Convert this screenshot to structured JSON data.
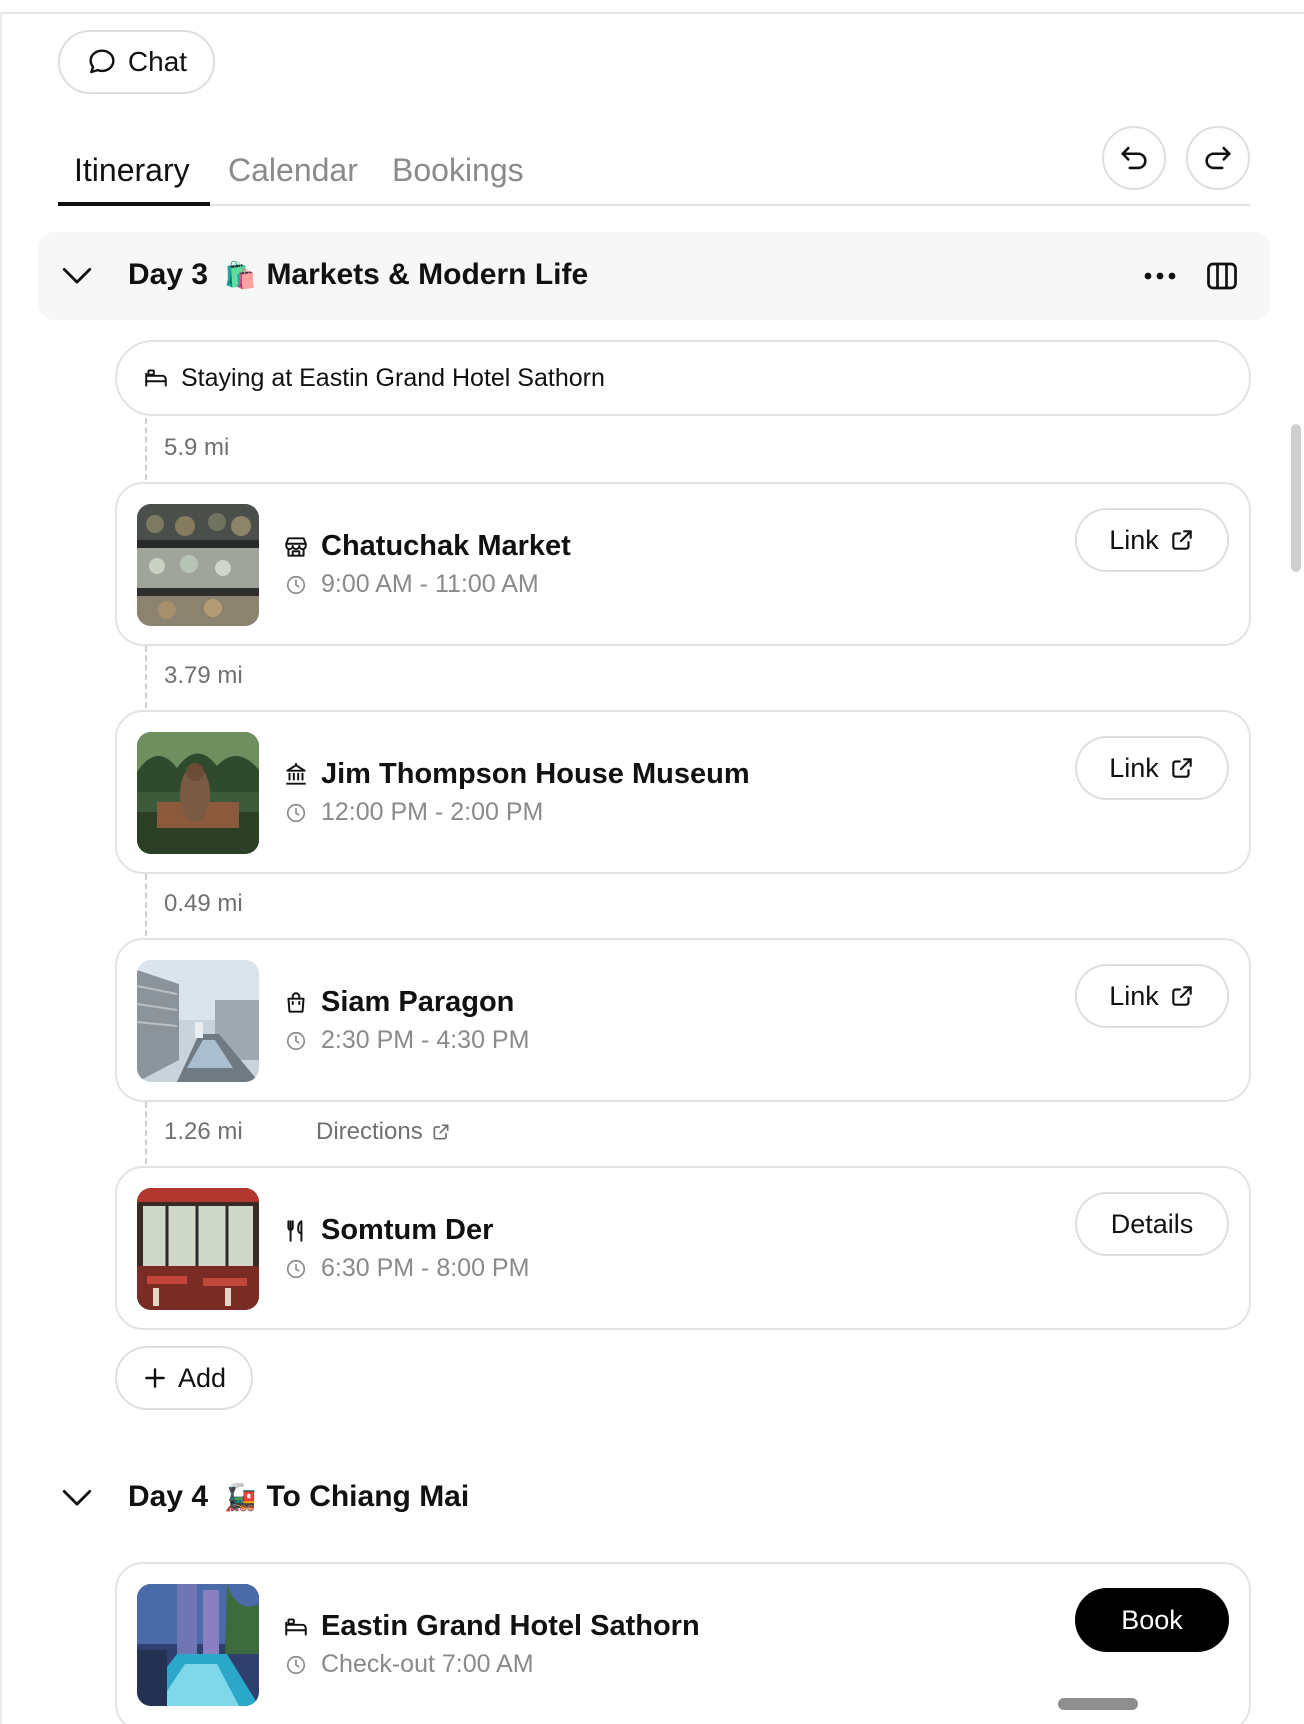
{
  "chat_button": {
    "label": "Chat",
    "icon": "chat-bubble-icon"
  },
  "tabs": [
    {
      "label": "Itinerary",
      "active": true
    },
    {
      "label": "Calendar",
      "active": false
    },
    {
      "label": "Bookings",
      "active": false
    }
  ],
  "toolbar": {
    "undo_icon": "undo-icon",
    "redo_icon": "redo-icon"
  },
  "day3": {
    "day_label": "Day 3",
    "emoji": "🛍️",
    "title": "Markets & Modern Life",
    "stay": "Staying at Eastin Grand Hotel Sathorn",
    "distances": [
      "5.9 mi",
      "3.79 mi",
      "0.49 mi",
      "1.26 mi"
    ],
    "directions_label": "Directions",
    "items": [
      {
        "name": "Chatuchak Market",
        "time": "9:00 AM  -  11:00 AM",
        "button": "Link",
        "icon": "storefront-icon"
      },
      {
        "name": "Jim Thompson House Museum",
        "time": "12:00 PM  -  2:00 PM",
        "button": "Link",
        "icon": "museum-icon"
      },
      {
        "name": "Siam Paragon",
        "time": "2:30 PM  -  4:30 PM",
        "button": "Link",
        "icon": "shopping-bag-icon"
      },
      {
        "name": "Somtum Der",
        "time": "6:30 PM  -  8:00 PM",
        "button": "Details",
        "icon": "fork-knife-icon"
      }
    ],
    "add_label": "Add"
  },
  "day4": {
    "day_label": "Day 4",
    "emoji": "🚂",
    "title": "To Chiang Mai",
    "items": [
      {
        "name": "Eastin Grand Hotel Sathorn",
        "time": "Check-out 7:00 AM",
        "button": "Book",
        "icon": "bed-icon"
      }
    ]
  },
  "colors": {
    "text": "#111111",
    "muted": "#8a8a8a",
    "border": "#e3e3e3",
    "day_header_bg": "#f7f7f7",
    "book_button": "#000000"
  }
}
